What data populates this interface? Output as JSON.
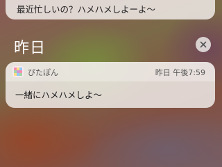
{
  "previous_notification": {
    "message": "最近忙しいの？ハメハメしよーよ〜"
  },
  "section": {
    "title": "昨日",
    "clear_icon": "close-icon"
  },
  "notification": {
    "app_icon": "app-icon",
    "app_name": "ぴたぽん",
    "time": "昨日 午後7:59",
    "message": "一緒にハメハメしよ〜"
  }
}
